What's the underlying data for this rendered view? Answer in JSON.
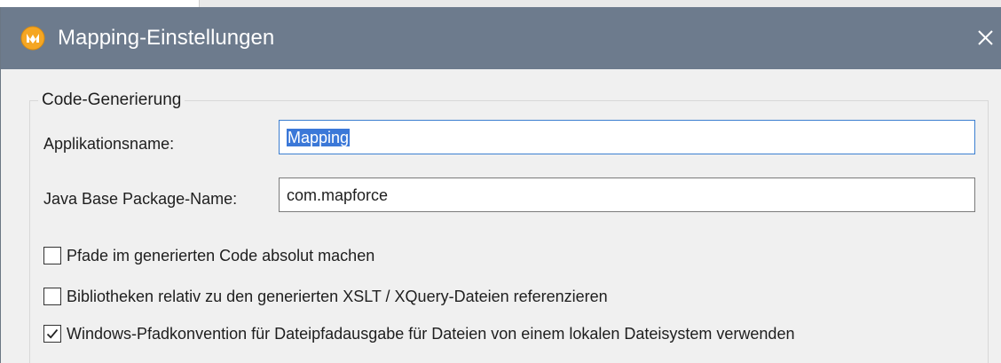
{
  "window": {
    "title": "Mapping-Einstellungen",
    "app_icon": "altova-mapforce-icon",
    "close_icon": "close-icon"
  },
  "code_generation": {
    "group_label": "Code-Generierung",
    "application_name_label": "Applikationsname:",
    "application_name_value": "Mapping",
    "java_package_label": "Java Base Package-Name:",
    "java_package_value": "com.mapforce"
  },
  "options": [
    {
      "label": "Pfade im generierten Code absolut machen",
      "checked": false
    },
    {
      "label": "Bibliotheken relativ zu den generierten XSLT / XQuery-Dateien referenzieren",
      "checked": false
    },
    {
      "label": "Windows-Pfadkonvention für Dateipfadausgabe für Dateien von einem lokalen Dateisystem verwenden",
      "checked": true
    }
  ],
  "colors": {
    "titlebar": "#6d7b8d",
    "dialog_bg": "#f0f0f0",
    "selection": "#3b78d8",
    "icon_orange": "#f5a623"
  }
}
